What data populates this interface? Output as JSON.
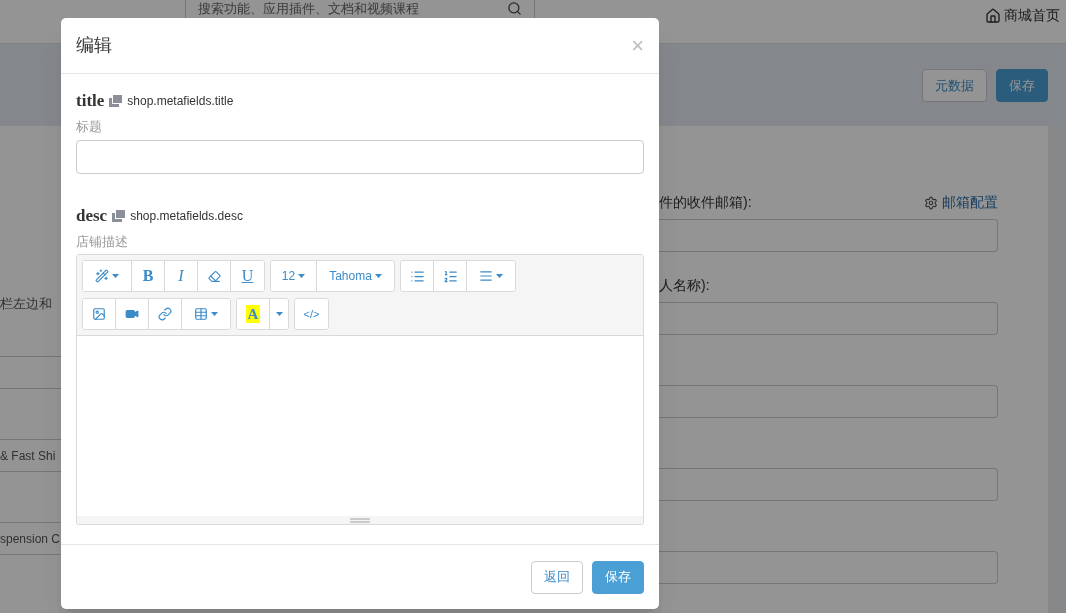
{
  "background": {
    "search": {
      "placeholder": "搜索功能、应用插件、文档和视频课程"
    },
    "home_link": "商城首页",
    "actions": [
      {
        "kind": "default",
        "label": "元数据"
      },
      {
        "kind": "primary",
        "label": "保存"
      }
    ],
    "left_text": "栏左边和",
    "left_fields": [
      {
        "kind": "blank"
      },
      {
        "kind": "filled",
        "value": "& Fast Shi"
      },
      {
        "kind": "filled",
        "value": "spension C"
      }
    ],
    "right_fields": [
      {
        "kind": "labeled",
        "label": "件的收件邮箱):",
        "link": "邮箱配置"
      },
      {
        "kind": "labeled",
        "label": "人名称):"
      },
      {
        "kind": "plain"
      },
      {
        "kind": "plain"
      },
      {
        "kind": "plain"
      }
    ]
  },
  "modal": {
    "title": "编辑",
    "close": "×",
    "fields": [
      {
        "kind": "input",
        "name": "title",
        "key": "shop.metafields.title",
        "label": "标题"
      },
      {
        "kind": "editor",
        "name": "desc",
        "key": "shop.metafields.desc",
        "label": "店铺描述"
      }
    ],
    "toolbar": {
      "bold": "B",
      "italic": "I",
      "underline": "U",
      "font_size": "12",
      "font_name": "Tahoma",
      "highlight": "A",
      "code": "</>"
    },
    "buttons": [
      {
        "kind": "default",
        "label": "返回"
      },
      {
        "kind": "primary",
        "label": "保存"
      }
    ]
  }
}
